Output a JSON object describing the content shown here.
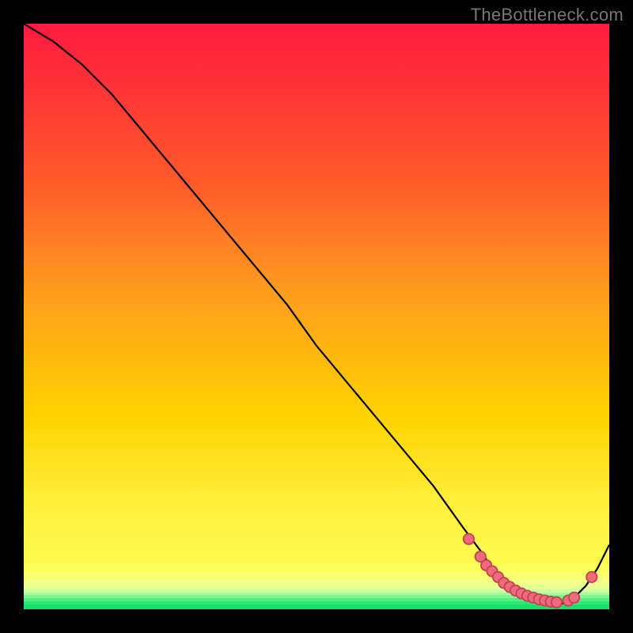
{
  "attribution": "TheBottleneck.com",
  "colors": {
    "frame_bg": "#000000",
    "gradient_top": "#ff193f",
    "gradient_mid": "#ffd400",
    "gradient_low": "#f7ff7a",
    "green": "#18e06b",
    "curve": "#000000",
    "marker_fill": "#ef6a7a",
    "marker_stroke": "#c24455"
  },
  "chart_data": {
    "type": "line",
    "title": "",
    "xlabel": "",
    "ylabel": "",
    "xlim": [
      0,
      100
    ],
    "ylim": [
      0,
      100
    ],
    "series": [
      {
        "name": "bottleneck-curve",
        "x": [
          0,
          5,
          10,
          15,
          20,
          25,
          30,
          35,
          40,
          45,
          50,
          55,
          60,
          65,
          70,
          75,
          78,
          80,
          82,
          84,
          86,
          88,
          90,
          92,
          94,
          96,
          98,
          100
        ],
        "y": [
          100,
          97,
          93,
          88,
          82,
          76,
          70,
          64,
          58,
          52,
          45,
          39,
          33,
          27,
          21,
          14,
          10,
          7,
          5,
          3,
          2,
          1,
          1,
          1,
          2,
          4,
          7,
          11
        ]
      }
    ],
    "markers": {
      "name": "highlighted-points",
      "x": [
        76,
        78,
        79,
        80,
        81,
        82,
        83,
        84,
        85,
        86,
        87,
        88,
        89,
        90,
        91,
        93,
        94,
        97
      ],
      "y": [
        12,
        9,
        7.5,
        6.5,
        5.5,
        4.5,
        3.8,
        3.2,
        2.7,
        2.3,
        2.0,
        1.7,
        1.5,
        1.3,
        1.2,
        1.5,
        2.0,
        5.5
      ]
    },
    "strata_from_bottom": [
      {
        "color": "#18e06b",
        "thickness_pct": 0.8
      },
      {
        "color": "#2ce874",
        "thickness_pct": 0.6
      },
      {
        "color": "#51ef7f",
        "thickness_pct": 0.5
      },
      {
        "color": "#7df68f",
        "thickness_pct": 0.5
      },
      {
        "color": "#a6fb9a",
        "thickness_pct": 0.5
      },
      {
        "color": "#c9ffa2",
        "thickness_pct": 0.5
      },
      {
        "color": "#e3ff9a",
        "thickness_pct": 0.7
      },
      {
        "color": "#f2ff86",
        "thickness_pct": 1.0
      },
      {
        "color": "#f9ff70",
        "thickness_pct": 1.2
      },
      {
        "color": "#fdff5c",
        "thickness_pct": 1.5
      },
      {
        "color": "#fff94e",
        "thickness_pct": 2.0
      }
    ],
    "gradient_remaining_pct": 90.2
  }
}
